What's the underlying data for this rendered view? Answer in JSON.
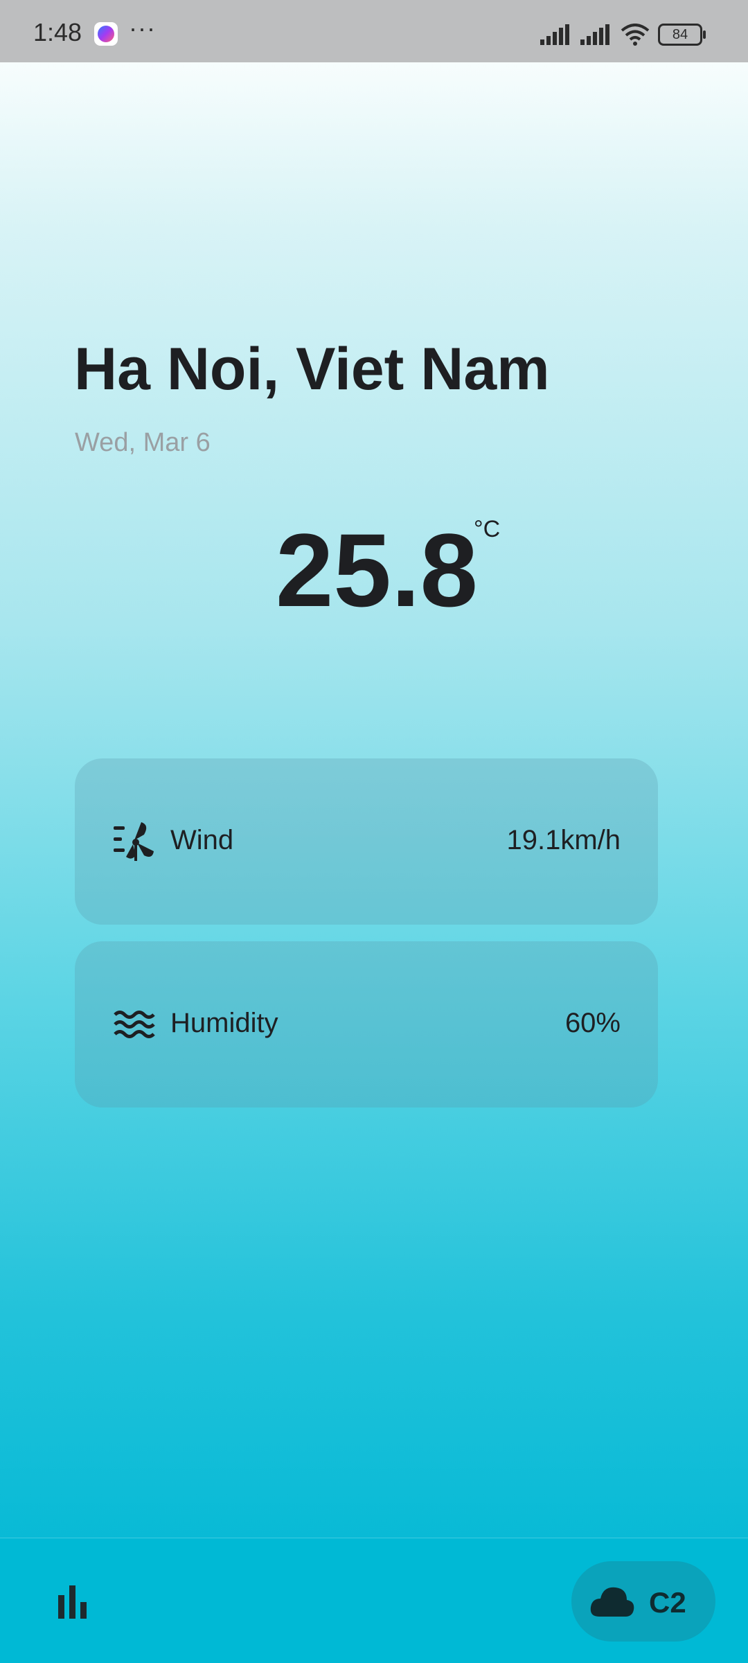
{
  "status_bar": {
    "time": "1:48",
    "notification_icons": [
      "messenger-icon",
      "more-dots-icon"
    ],
    "more": "···",
    "battery": "84"
  },
  "weather": {
    "city": "Ha Noi, Viet Nam",
    "date": "Wed, Mar 6",
    "temperature": "25.8",
    "unit": "°C"
  },
  "details": {
    "wind": {
      "label": "Wind",
      "value": "19.1km/h",
      "icon": "wind-fan-icon"
    },
    "humidity": {
      "label": "Humidity",
      "value": "60%",
      "icon": "waves-icon"
    }
  },
  "bottom_bar": {
    "chart_icon": "bar-chart-icon",
    "mode_icon": "cloud-icon",
    "mode_label": "C2"
  },
  "colors": {
    "gradient_top": "#f7fdfd",
    "gradient_bottom": "#00b9d5",
    "card": "#7fc5cf",
    "mode_button": "#0aa3bb",
    "date_text": "#9a9fa3"
  }
}
